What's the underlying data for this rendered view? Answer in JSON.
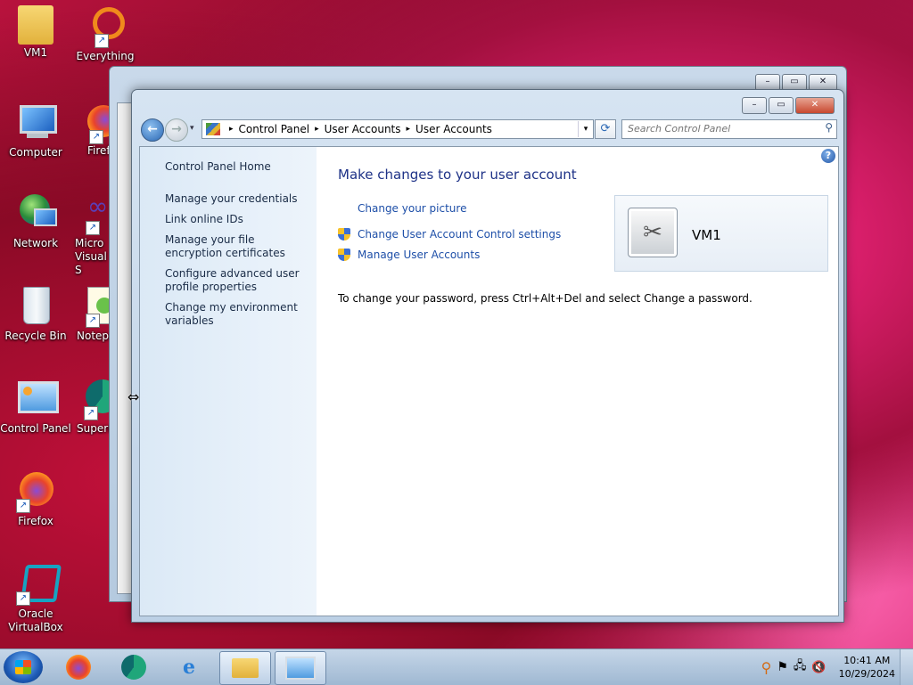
{
  "desktop": {
    "icons": [
      {
        "label": "VM1",
        "glyph": "📁"
      },
      {
        "label": "Everything",
        "glyph": "◯"
      },
      {
        "label": "Computer",
        "glyph": "🖥"
      },
      {
        "label": "Firef",
        "glyph": "🦊"
      },
      {
        "label": "Network",
        "glyph": "🌐"
      },
      {
        "label": "Micro Visual S",
        "glyph": "∞"
      },
      {
        "label": "Recycle Bin",
        "glyph": "🗑"
      },
      {
        "label": "Notepa",
        "glyph": "📝"
      },
      {
        "label": "Control Panel",
        "glyph": "⚙"
      },
      {
        "label": "Superm",
        "glyph": "◐"
      },
      {
        "label": "Firefox",
        "glyph": "🦊"
      },
      {
        "label": "Oracle VirtualBox",
        "glyph": "▣"
      }
    ]
  },
  "window": {
    "caption_buttons": {
      "minimize": "–",
      "maximize": "▭",
      "close": "✕"
    },
    "nav": {
      "back": "←",
      "forward": "→",
      "dropdown": "▾"
    },
    "breadcrumb": [
      "Control Panel",
      "User Accounts",
      "User Accounts"
    ],
    "breadcrumb_sep": "▸",
    "refresh_icon": "⟳",
    "search": {
      "placeholder": "Search Control Panel"
    },
    "help": "?"
  },
  "sidebar": {
    "home": "Control Panel Home",
    "links": [
      "Manage your credentials",
      "Link online IDs",
      "Manage your file encryption certificates",
      "Configure advanced user profile properties",
      "Change my environment variables"
    ]
  },
  "content": {
    "heading": "Make changes to your user account",
    "tasks": [
      {
        "label": "Change your picture",
        "shield": false
      },
      {
        "label": "Change User Account Control settings",
        "shield": true
      },
      {
        "label": "Manage User Accounts",
        "shield": true
      }
    ],
    "password_note": "To change your password, press Ctrl+Alt+Del and select Change a password.",
    "user": {
      "name": "VM1"
    }
  },
  "taskbar": {
    "apps": [
      "firefox",
      "supermium",
      "internet-explorer",
      "file-explorer",
      "control-panel"
    ],
    "clock": {
      "time": "10:41 AM",
      "date": "10/29/2024"
    }
  }
}
